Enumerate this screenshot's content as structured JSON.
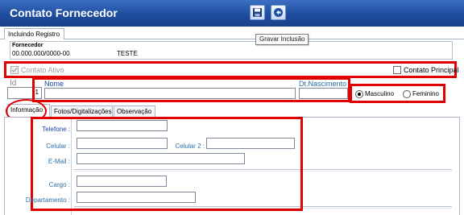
{
  "window": {
    "title": "Contato Fornecedor"
  },
  "toolbar": {
    "save_icon": "floppy-disk-icon",
    "back_icon": "back-arrow-icon",
    "tooltip": "Gravar Inclusão"
  },
  "tabs": {
    "registro": "Incluindo Registro"
  },
  "fornecedor": {
    "label": "Fornecedor",
    "code": "00.000.000/0000-00",
    "name": "TESTE"
  },
  "flags": {
    "contato_ativo": "Contato Ativo",
    "contato_principal": "Contato Principal"
  },
  "header_fields": {
    "id_label": "Id",
    "id_value": "-1",
    "nome_label": "Nome",
    "nome_value": "",
    "dt_label": "Dt.Nascimento",
    "dt_value": ""
  },
  "gender": {
    "masculino": "Masculino",
    "feminino": "Feminino",
    "selected": "Masculino"
  },
  "inner_tabs": [
    "Informação",
    "Fotos/Digitalizações",
    "Observação"
  ],
  "form": {
    "telefone": {
      "label": "Telefone :",
      "value": ""
    },
    "celular": {
      "label": "Celular :",
      "value": ""
    },
    "celular2": {
      "label": "Celular 2 :",
      "value": ""
    },
    "email": {
      "label": "E-Mail :",
      "value": ""
    },
    "cargo": {
      "label": "Cargo :",
      "value": ""
    },
    "departamento": {
      "label": "Departamento :",
      "value": ""
    }
  },
  "colors": {
    "titlebar": "#1f4d9e",
    "highlight": "#e00000",
    "label_blue": "#1a3fa8"
  }
}
